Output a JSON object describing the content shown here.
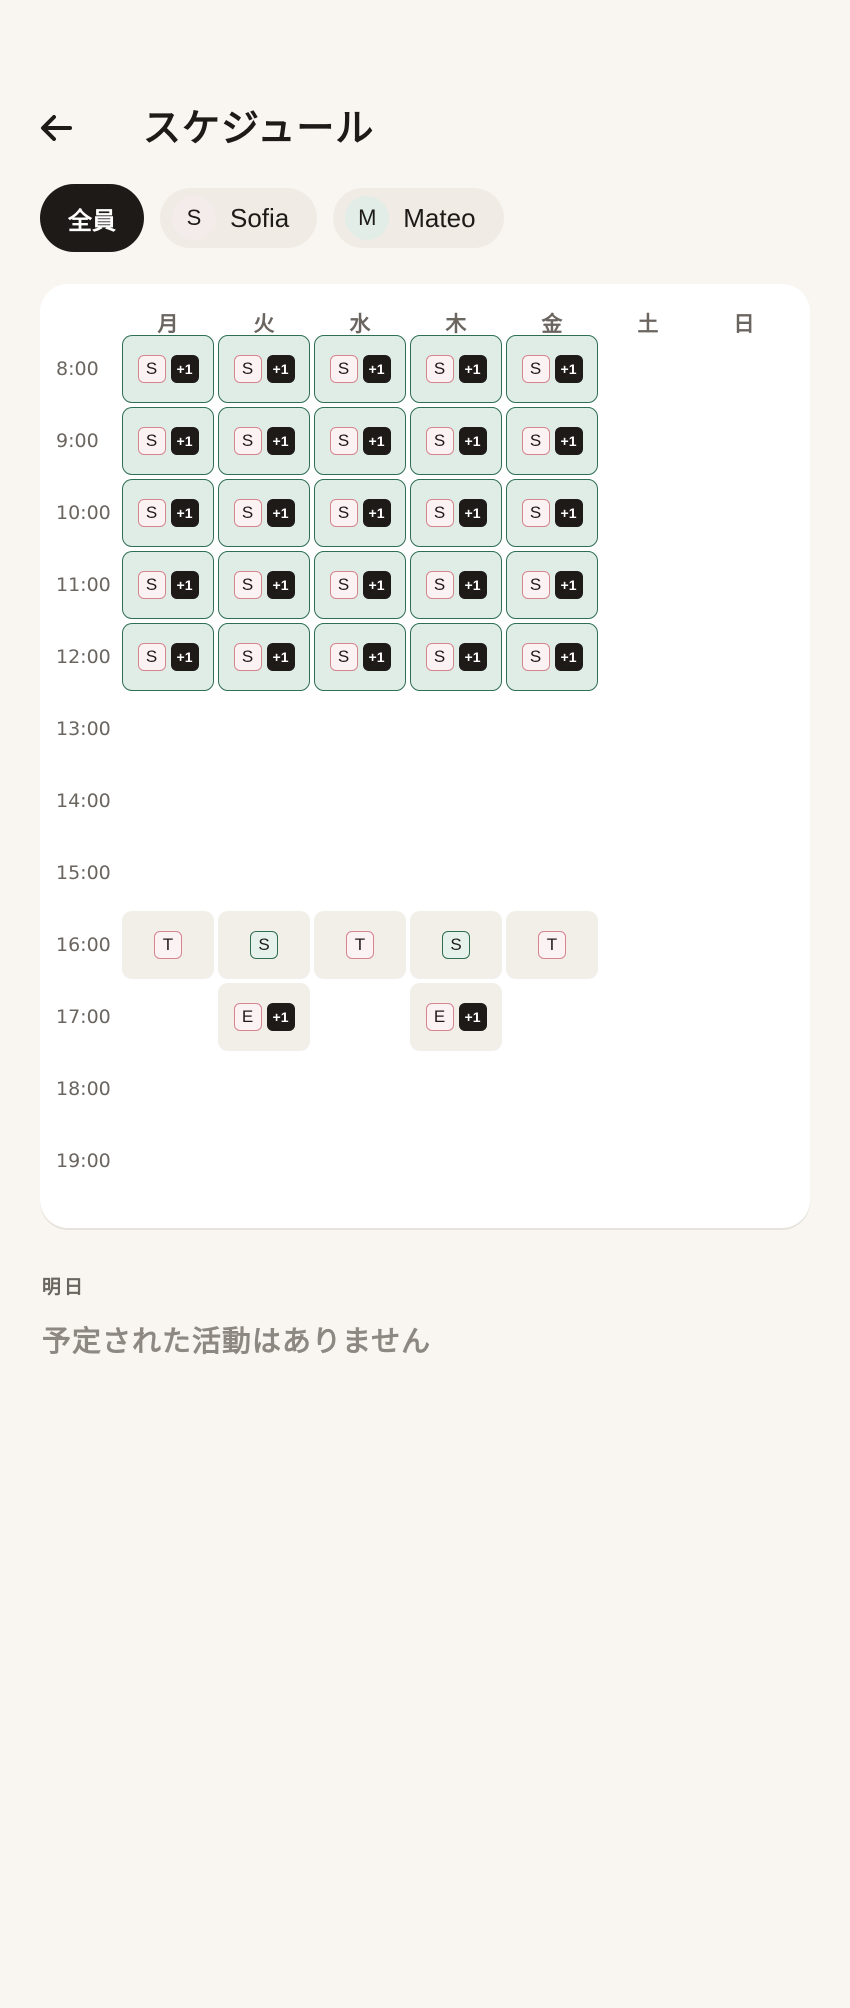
{
  "header": {
    "title": "スケジュール",
    "back_icon": "arrow-left-icon"
  },
  "filters": {
    "all": "全員",
    "people": [
      {
        "initial": "S",
        "name": "Sofia"
      },
      {
        "initial": "M",
        "name": "Mateo"
      }
    ]
  },
  "calendar": {
    "days": [
      "月",
      "火",
      "水",
      "木",
      "金",
      "土",
      "日"
    ],
    "times": [
      "8:00",
      "9:00",
      "10:00",
      "11:00",
      "12:00",
      "13:00",
      "14:00",
      "15:00",
      "16:00",
      "17:00",
      "18:00",
      "19:00"
    ],
    "events": [
      {
        "day": 0,
        "time": 0,
        "style": "green",
        "badges": [
          {
            "t": "S",
            "c": "pink"
          },
          {
            "t": "+1",
            "c": "plus"
          }
        ]
      },
      {
        "day": 1,
        "time": 0,
        "style": "green",
        "badges": [
          {
            "t": "S",
            "c": "pink"
          },
          {
            "t": "+1",
            "c": "plus"
          }
        ]
      },
      {
        "day": 2,
        "time": 0,
        "style": "green",
        "badges": [
          {
            "t": "S",
            "c": "pink"
          },
          {
            "t": "+1",
            "c": "plus"
          }
        ]
      },
      {
        "day": 3,
        "time": 0,
        "style": "green",
        "badges": [
          {
            "t": "S",
            "c": "pink"
          },
          {
            "t": "+1",
            "c": "plus"
          }
        ]
      },
      {
        "day": 4,
        "time": 0,
        "style": "green",
        "badges": [
          {
            "t": "S",
            "c": "pink"
          },
          {
            "t": "+1",
            "c": "plus"
          }
        ]
      },
      {
        "day": 0,
        "time": 1,
        "style": "green",
        "badges": [
          {
            "t": "S",
            "c": "pink"
          },
          {
            "t": "+1",
            "c": "plus"
          }
        ]
      },
      {
        "day": 1,
        "time": 1,
        "style": "green",
        "badges": [
          {
            "t": "S",
            "c": "pink"
          },
          {
            "t": "+1",
            "c": "plus"
          }
        ]
      },
      {
        "day": 2,
        "time": 1,
        "style": "green",
        "badges": [
          {
            "t": "S",
            "c": "pink"
          },
          {
            "t": "+1",
            "c": "plus"
          }
        ]
      },
      {
        "day": 3,
        "time": 1,
        "style": "green",
        "badges": [
          {
            "t": "S",
            "c": "pink"
          },
          {
            "t": "+1",
            "c": "plus"
          }
        ]
      },
      {
        "day": 4,
        "time": 1,
        "style": "green",
        "badges": [
          {
            "t": "S",
            "c": "pink"
          },
          {
            "t": "+1",
            "c": "plus"
          }
        ]
      },
      {
        "day": 0,
        "time": 2,
        "style": "green",
        "badges": [
          {
            "t": "S",
            "c": "pink"
          },
          {
            "t": "+1",
            "c": "plus"
          }
        ]
      },
      {
        "day": 1,
        "time": 2,
        "style": "green",
        "badges": [
          {
            "t": "S",
            "c": "pink"
          },
          {
            "t": "+1",
            "c": "plus"
          }
        ]
      },
      {
        "day": 2,
        "time": 2,
        "style": "green",
        "badges": [
          {
            "t": "S",
            "c": "pink"
          },
          {
            "t": "+1",
            "c": "plus"
          }
        ]
      },
      {
        "day": 3,
        "time": 2,
        "style": "green",
        "badges": [
          {
            "t": "S",
            "c": "pink"
          },
          {
            "t": "+1",
            "c": "plus"
          }
        ]
      },
      {
        "day": 4,
        "time": 2,
        "style": "green",
        "badges": [
          {
            "t": "S",
            "c": "pink"
          },
          {
            "t": "+1",
            "c": "plus"
          }
        ]
      },
      {
        "day": 0,
        "time": 3,
        "style": "green",
        "badges": [
          {
            "t": "S",
            "c": "pink"
          },
          {
            "t": "+1",
            "c": "plus"
          }
        ]
      },
      {
        "day": 1,
        "time": 3,
        "style": "green",
        "badges": [
          {
            "t": "S",
            "c": "pink"
          },
          {
            "t": "+1",
            "c": "plus"
          }
        ]
      },
      {
        "day": 2,
        "time": 3,
        "style": "green",
        "badges": [
          {
            "t": "S",
            "c": "pink"
          },
          {
            "t": "+1",
            "c": "plus"
          }
        ]
      },
      {
        "day": 3,
        "time": 3,
        "style": "green",
        "badges": [
          {
            "t": "S",
            "c": "pink"
          },
          {
            "t": "+1",
            "c": "plus"
          }
        ]
      },
      {
        "day": 4,
        "time": 3,
        "style": "green",
        "badges": [
          {
            "t": "S",
            "c": "pink"
          },
          {
            "t": "+1",
            "c": "plus"
          }
        ]
      },
      {
        "day": 0,
        "time": 4,
        "style": "green",
        "badges": [
          {
            "t": "S",
            "c": "pink"
          },
          {
            "t": "+1",
            "c": "plus"
          }
        ]
      },
      {
        "day": 1,
        "time": 4,
        "style": "green",
        "badges": [
          {
            "t": "S",
            "c": "pink"
          },
          {
            "t": "+1",
            "c": "plus"
          }
        ]
      },
      {
        "day": 2,
        "time": 4,
        "style": "green",
        "badges": [
          {
            "t": "S",
            "c": "pink"
          },
          {
            "t": "+1",
            "c": "plus"
          }
        ]
      },
      {
        "day": 3,
        "time": 4,
        "style": "green",
        "badges": [
          {
            "t": "S",
            "c": "pink"
          },
          {
            "t": "+1",
            "c": "plus"
          }
        ]
      },
      {
        "day": 4,
        "time": 4,
        "style": "green",
        "badges": [
          {
            "t": "S",
            "c": "pink"
          },
          {
            "t": "+1",
            "c": "plus"
          }
        ]
      },
      {
        "day": 0,
        "time": 8,
        "style": "beige",
        "badges": [
          {
            "t": "T",
            "c": "pink"
          }
        ]
      },
      {
        "day": 1,
        "time": 8,
        "style": "beige",
        "badges": [
          {
            "t": "S",
            "c": "teal"
          }
        ]
      },
      {
        "day": 2,
        "time": 8,
        "style": "beige",
        "badges": [
          {
            "t": "T",
            "c": "pink"
          }
        ]
      },
      {
        "day": 3,
        "time": 8,
        "style": "beige",
        "badges": [
          {
            "t": "S",
            "c": "teal"
          }
        ]
      },
      {
        "day": 4,
        "time": 8,
        "style": "beige",
        "badges": [
          {
            "t": "T",
            "c": "pink"
          }
        ]
      },
      {
        "day": 1,
        "time": 9,
        "style": "beige",
        "badges": [
          {
            "t": "E",
            "c": "pink"
          },
          {
            "t": "+1",
            "c": "plus"
          }
        ]
      },
      {
        "day": 3,
        "time": 9,
        "style": "beige",
        "badges": [
          {
            "t": "E",
            "c": "pink"
          },
          {
            "t": "+1",
            "c": "plus"
          }
        ]
      }
    ]
  },
  "tomorrow": {
    "label": "明日",
    "empty_message": "予定された活動はありません"
  },
  "colors": {
    "background": "#f9f6f2",
    "primary": "#1e1a17",
    "event_green": "#dfede6",
    "event_green_border": "#2e6e52",
    "event_beige": "#f2eee8",
    "badge_pink": "#d6858f"
  }
}
